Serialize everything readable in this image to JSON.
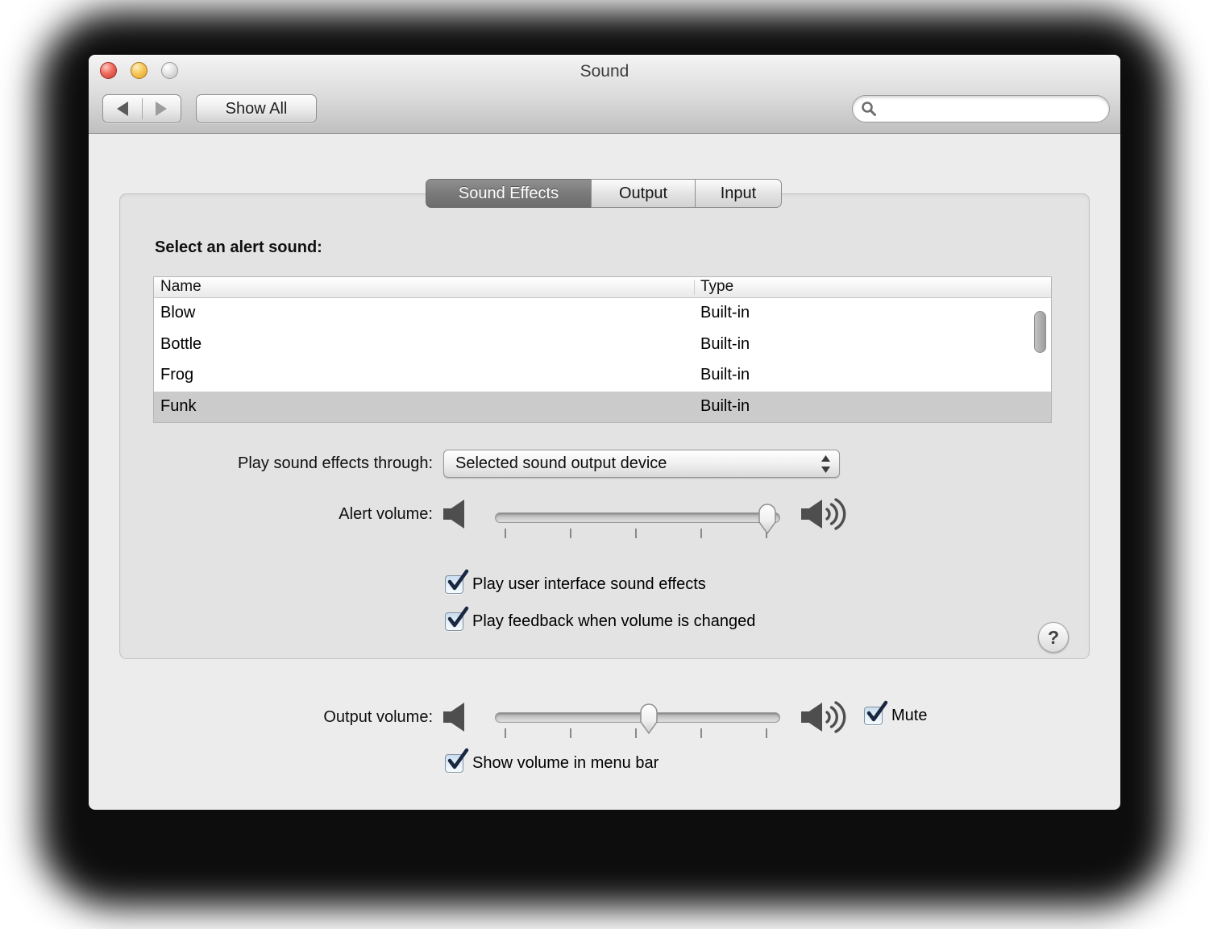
{
  "window": {
    "title": "Sound"
  },
  "toolbar": {
    "show_all_label": "Show All"
  },
  "search": {
    "value": "",
    "placeholder": ""
  },
  "tabs": [
    {
      "label": "Sound Effects",
      "selected": true
    },
    {
      "label": "Output",
      "selected": false
    },
    {
      "label": "Input",
      "selected": false
    }
  ],
  "alert_panel": {
    "heading": "Select an alert sound:",
    "table": {
      "columns": [
        "Name",
        "Type"
      ],
      "rows": [
        {
          "name": "Blow",
          "type": "Built-in",
          "selected": false
        },
        {
          "name": "Bottle",
          "type": "Built-in",
          "selected": false
        },
        {
          "name": "Frog",
          "type": "Built-in",
          "selected": false
        },
        {
          "name": "Funk",
          "type": "Built-in",
          "selected": true
        }
      ]
    },
    "play_through_label": "Play sound effects through:",
    "play_through_value": "Selected sound output device",
    "alert_volume_label": "Alert volume:",
    "alert_volume_percent": 100,
    "checkbox_ui_sounds": {
      "label": "Play user interface sound effects",
      "checked": true
    },
    "checkbox_feedback": {
      "label": "Play feedback when volume is changed",
      "checked": true
    },
    "help_label": "?"
  },
  "output_panel": {
    "output_volume_label": "Output volume:",
    "output_volume_percent": 55,
    "mute": {
      "label": "Mute",
      "checked": true
    },
    "show_volume": {
      "label": "Show volume in menu bar",
      "checked": true
    }
  },
  "colors": {
    "selected_row": "#cbcbcb",
    "selected_tab": "#7a7a7a",
    "checkmark": "#1a2740",
    "speaker_icon": "#4e4e4e"
  }
}
